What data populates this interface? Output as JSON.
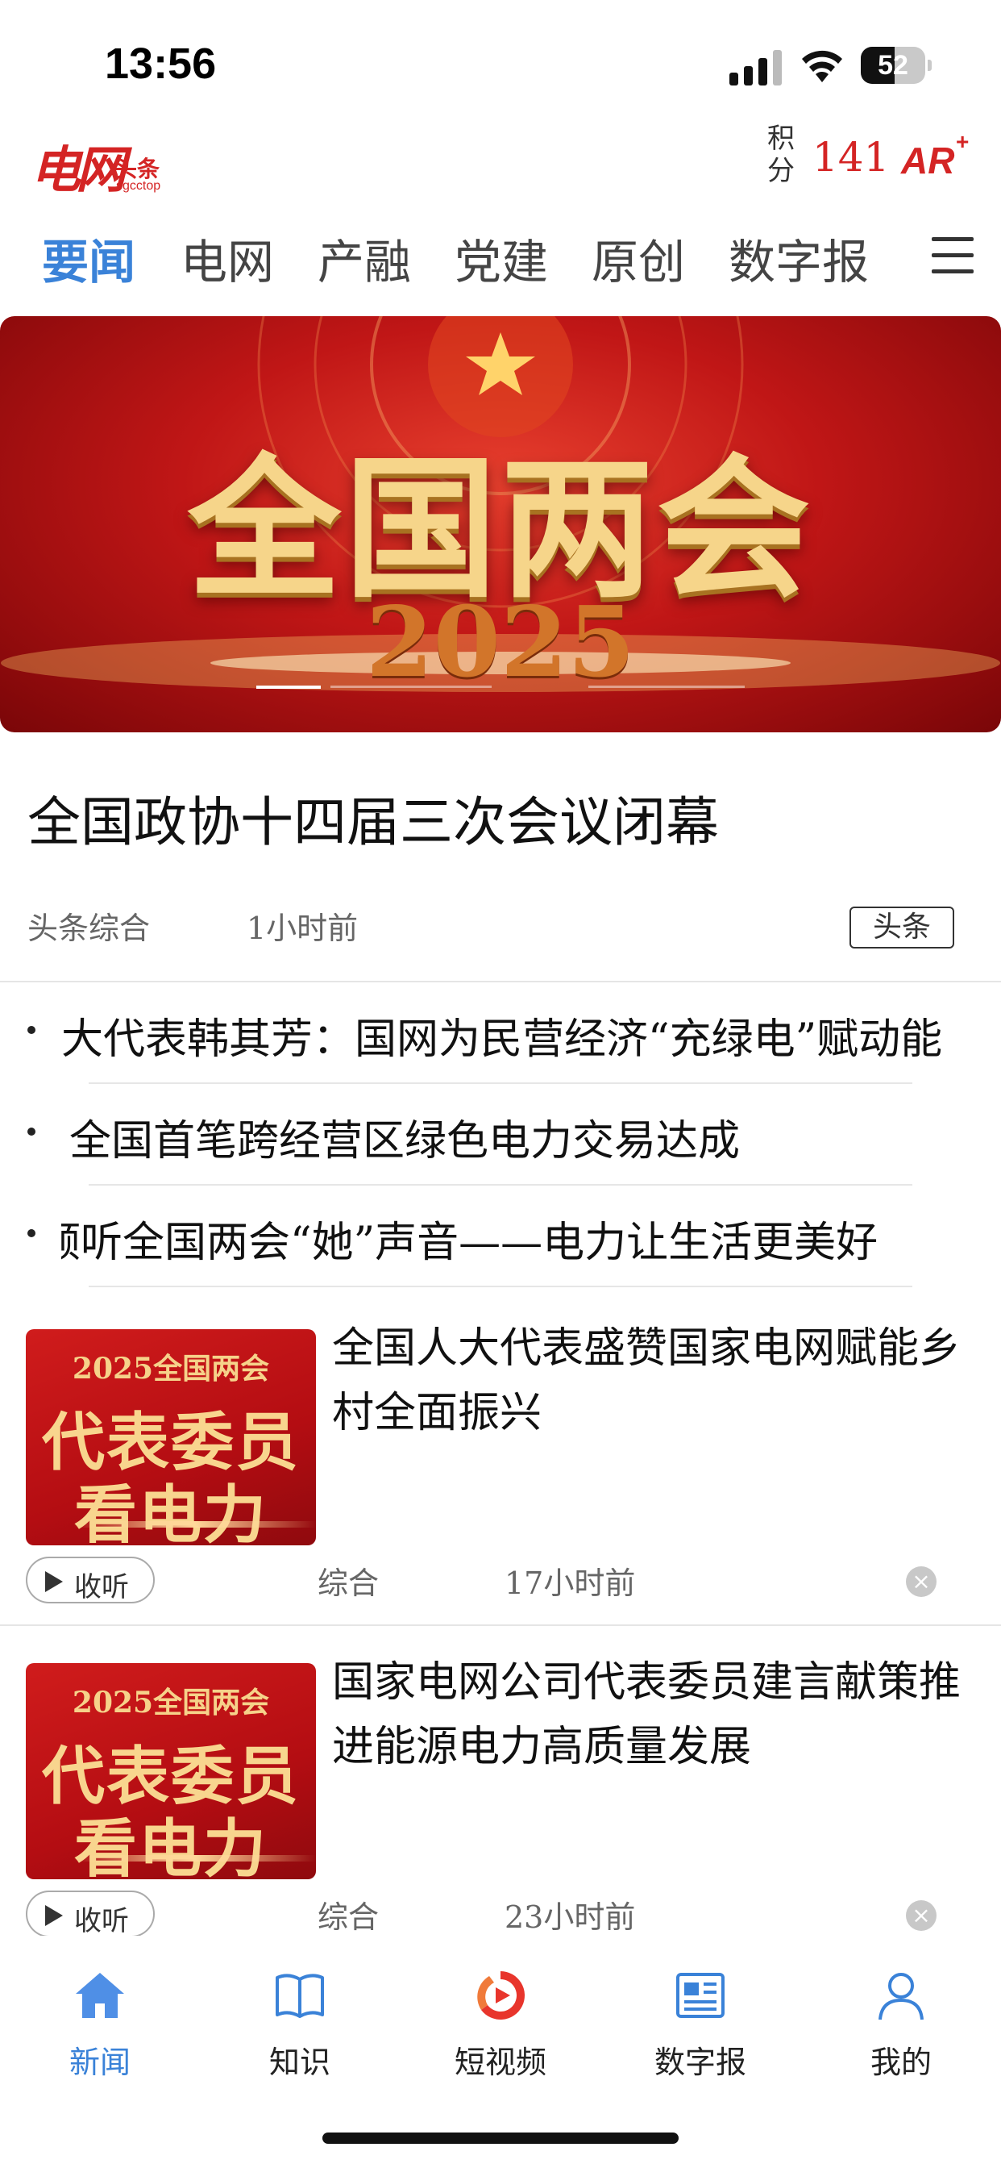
{
  "status_bar": {
    "time": "13:56",
    "battery": "52",
    "battery_level": 0.52
  },
  "header": {
    "logo_main": "电网",
    "logo_sub": "头条",
    "logo_en": "sgcctop",
    "points_label": "积分",
    "points_value": "141",
    "ar_label": "AR",
    "ar_plus": "+"
  },
  "tabs": [
    {
      "label": "要闻",
      "active": true
    },
    {
      "label": "电网"
    },
    {
      "label": "产融"
    },
    {
      "label": "党建"
    },
    {
      "label": "原创"
    },
    {
      "label": "数字报"
    }
  ],
  "banner": {
    "title": "全国两会",
    "year": "2025",
    "slides": 3,
    "active_slide": 0
  },
  "headline": {
    "title": "全国政协十四届三次会议闭幕",
    "source": "头条综合",
    "time": "1小时前",
    "tag": "头条"
  },
  "bullets": [
    {
      "text": "人大代表韩其芳：国网为民营经济“充绿电”赋动能"
    },
    {
      "text": "全国首笔跨经营区绿色电力交易达成"
    },
    {
      "text": "倾听全国两会“她”声音——电力让生活更美好"
    }
  ],
  "cards": [
    {
      "thumb_line1": "2025全国两会",
      "thumb_line2": "代表委员",
      "thumb_line3": "看电力",
      "title": "全国人大代表盛赞国家电网赋能乡村全面振兴",
      "listen_label": "收听",
      "category": "综合",
      "time": "17小时前"
    },
    {
      "thumb_line1": "2025全国两会",
      "thumb_line2": "代表委员",
      "thumb_line3": "看电力",
      "title": "国家电网公司代表委员建言献策推进能源电力高质量发展",
      "listen_label": "收听",
      "category": "综合",
      "time": "23小时前"
    }
  ],
  "tabbar": [
    {
      "label": "新闻",
      "icon": "home-icon",
      "active": true
    },
    {
      "label": "知识",
      "icon": "book-icon"
    },
    {
      "label": "短视频",
      "icon": "video-icon"
    },
    {
      "label": "数字报",
      "icon": "newspaper-icon"
    },
    {
      "label": "我的",
      "icon": "profile-icon"
    }
  ],
  "colors": {
    "accent": "#3a82d8",
    "brand_red": "#d42424"
  }
}
